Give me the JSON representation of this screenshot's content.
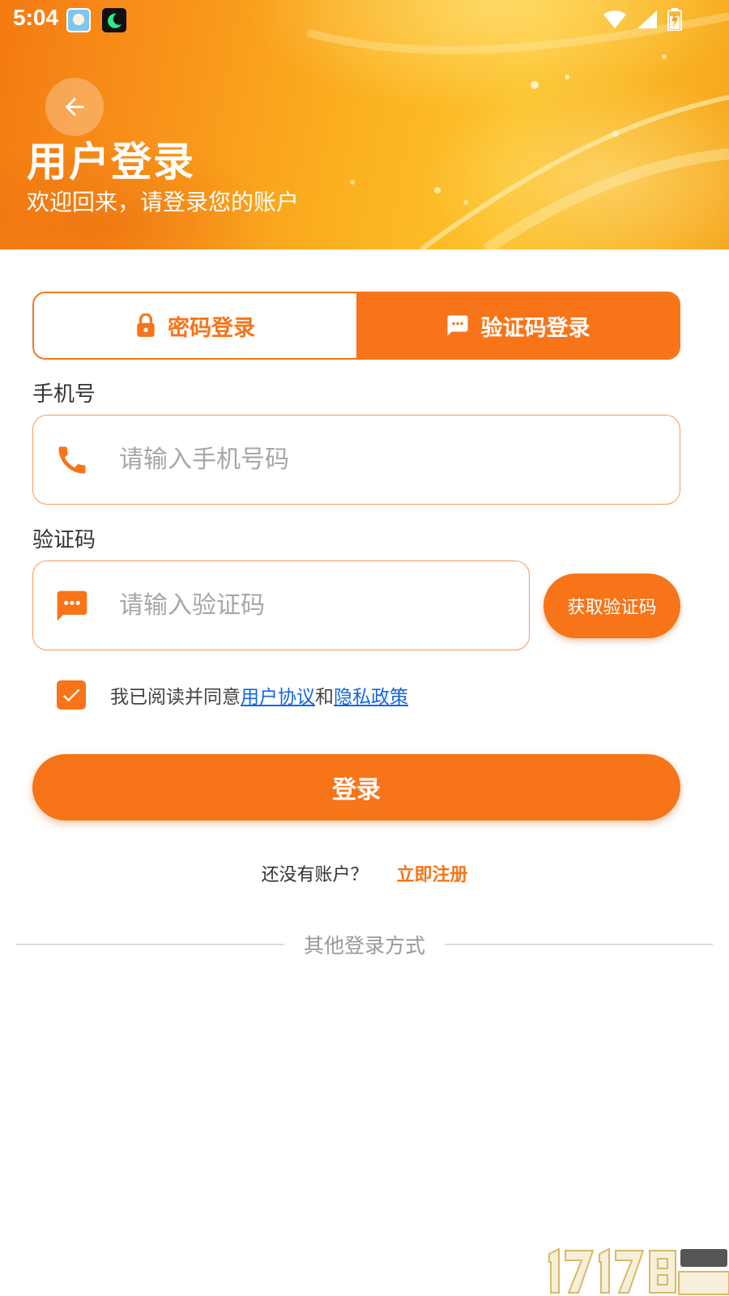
{
  "status_bar": {
    "time": "5:04"
  },
  "header": {
    "title": "用户登录",
    "subtitle": "欢迎回来，请登录您的账户",
    "back_icon": "arrow-left-icon"
  },
  "tabs": [
    {
      "label": "密码登录",
      "icon": "lock-icon",
      "active": false
    },
    {
      "label": "验证码登录",
      "icon": "message-icon",
      "active": true
    }
  ],
  "phone_field": {
    "label": "手机号",
    "placeholder": "请输入手机号码",
    "value": "",
    "icon": "phone-icon"
  },
  "code_field": {
    "label": "验证码",
    "placeholder": "请输入验证码",
    "value": "",
    "icon": "sms-icon"
  },
  "get_code_button": {
    "label": "获取验证码"
  },
  "agreement": {
    "checked": true,
    "prefix": "我已阅读并同意",
    "user_agreement": "用户协议",
    "conjunction": "和",
    "privacy_policy": "隐私政策"
  },
  "login_button": {
    "label": "登录"
  },
  "register": {
    "prompt": "还没有账户？",
    "link": "立即注册"
  },
  "other_login": {
    "label": "其他登录方式"
  },
  "colors": {
    "primary": "#f77419",
    "link": "#1565e0",
    "header_start": "#f47a12",
    "header_end": "#fdc22a"
  }
}
